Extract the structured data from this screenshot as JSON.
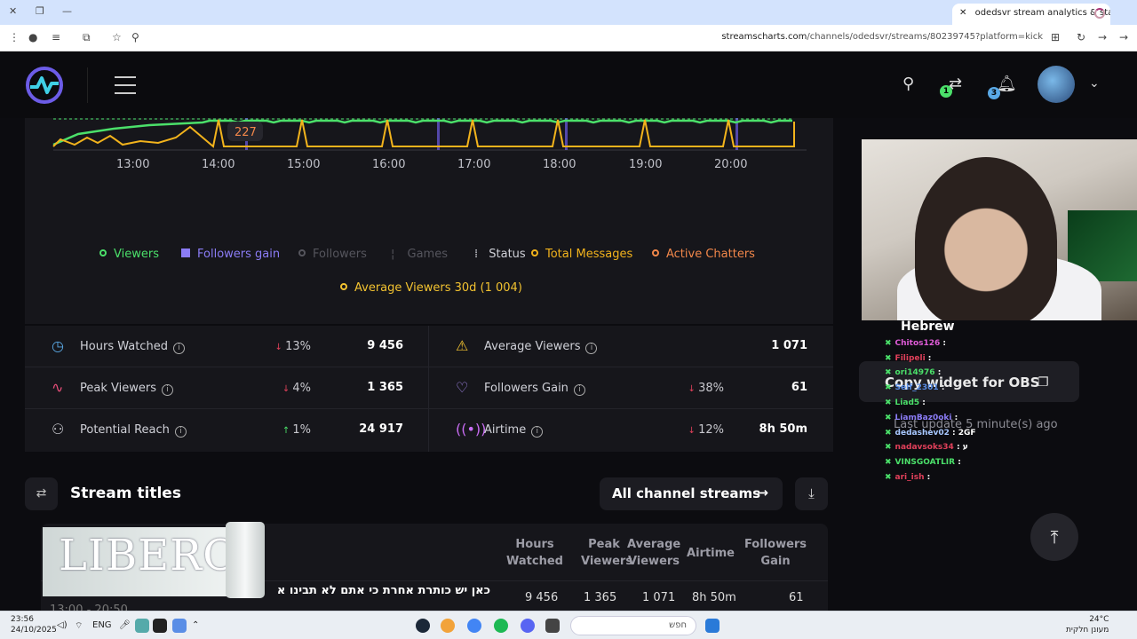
{
  "browser": {
    "tab_title": "odedsvr stream analytics & stat",
    "url_host": "streamscharts.com",
    "url_path": "/channels/odedsvr/streams/80239745?platform=kick"
  },
  "header": {
    "notifications_messages": "1",
    "notifications_bell": "3"
  },
  "chart": {
    "x_ticks": [
      "13:00",
      "14:00",
      "15:00",
      "16:00",
      "17:00",
      "18:00",
      "19:00",
      "20:00"
    ],
    "tooltip_value": "227",
    "legend": [
      {
        "label": "Viewers",
        "color": "#4be06a"
      },
      {
        "label": "Followers gain",
        "color": "#8b7cf6"
      },
      {
        "label": "Followers",
        "color": "#55555d"
      },
      {
        "label": "Games",
        "color": "#55555d"
      },
      {
        "label": "Status",
        "color": "#d0d1d8"
      },
      {
        "label": "Total Messages",
        "color": "#f2b31c"
      },
      {
        "label": "Active Chatters",
        "color": "#f2874a"
      }
    ],
    "legend2": {
      "label": "Average Viewers 30d (1 004)",
      "color": "#f2c230"
    }
  },
  "chart_data": {
    "type": "line",
    "x_ticks": [
      "13:00",
      "14:00",
      "15:00",
      "16:00",
      "17:00",
      "18:00",
      "19:00",
      "20:00"
    ],
    "series": [
      {
        "name": "Viewers",
        "color": "#4be06a"
      },
      {
        "name": "Total Messages",
        "color": "#f2b31c"
      },
      {
        "name": "Active Chatters",
        "color": "#f2874a"
      }
    ]
  },
  "stats": [
    {
      "label": "Hours Watched",
      "dir": "down",
      "pct": "13%",
      "value": "9 456",
      "color": "#5aa9e6"
    },
    {
      "label": "Average Viewers",
      "dir": "",
      "pct": "",
      "value": "1 071",
      "color": "#f2c230"
    },
    {
      "label": "Peak Viewers",
      "dir": "down",
      "pct": "4%",
      "value": "1 365",
      "color": "#ea4f7a"
    },
    {
      "label": "Followers Gain",
      "dir": "down",
      "pct": "38%",
      "value": "61",
      "color": "#a88cf2"
    },
    {
      "label": "Potential Reach",
      "dir": "up",
      "pct": "1%",
      "value": "24 917",
      "color": "#c8c8ce"
    },
    {
      "label": "Airtime",
      "dir": "down",
      "pct": "12%",
      "value": "8h 50m",
      "color": "#c86cf2"
    }
  ],
  "titles": {
    "heading": "Stream titles",
    "all_streams_button": "All channel streams",
    "columns": [
      "Hours Watched",
      "Peak Viewers",
      "Average Viewers",
      "Airtime",
      "Followers Gain"
    ],
    "row": {
      "title": "כאן יש כותרת אחרת כי אתם לא תבינו א",
      "time": "13:00 - 20:50",
      "hours_watched": "9 456",
      "peak_viewers": "1 365",
      "average_viewers": "1 071",
      "airtime": "8h 50m",
      "followers_gain": "61"
    },
    "ad_text": "LIBERO"
  },
  "overlay": {
    "widget_button": "Copy widget for OBS",
    "last_update": "Last update 5 minute(s) ago",
    "hebrew_label": "Hebrew",
    "chat": [
      {
        "user": "Chitos126",
        "msg": "",
        "color": "#e05cd8"
      },
      {
        "user": "Filipeli",
        "msg": "",
        "color": "#e0405a"
      },
      {
        "user": "ori14976",
        "msg": "",
        "color": "#4be06a"
      },
      {
        "user": "Self_2301",
        "msg": "",
        "color": "#5a8ee6"
      },
      {
        "user": "Liad5",
        "msg": "",
        "color": "#4be06a"
      },
      {
        "user": "LiamBaz0oki",
        "msg": "",
        "color": "#8b7cf6"
      },
      {
        "user": "dedashev02",
        "msg": "2GF",
        "color": "#a8c8ff"
      },
      {
        "user": "nadavsoks34",
        "msg": "ע",
        "color": "#e0405a"
      },
      {
        "user": "VINSGOATLIR",
        "msg": "",
        "color": "#4be06a"
      },
      {
        "user": "ari_ish",
        "msg": "",
        "color": "#e0405a"
      }
    ]
  },
  "taskbar": {
    "time": "23:56",
    "date": "24/10/2025",
    "lang": "ENG",
    "search_placeholder": "חפש",
    "temp": "24°C",
    "weather": "מעונן חלקית"
  }
}
